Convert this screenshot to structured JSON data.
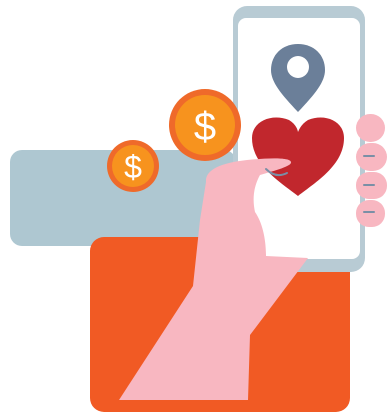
{
  "illustration": {
    "coin_symbol": "$",
    "colors": {
      "background": "#ffffff",
      "blue_gray_card": "#aec7d1",
      "orange_card": "#f15a24",
      "phone_frame": "#b8cbd4",
      "phone_screen": "#ffffff",
      "location_pin": "#6b7f99",
      "heart": "#c1272d",
      "hand": "#f8b7c1",
      "hand_line": "#7a8fa6",
      "coin_fill": "#f7931e",
      "coin_ring": "#ef6a2a",
      "coin_symbol": "#ffffff"
    }
  }
}
